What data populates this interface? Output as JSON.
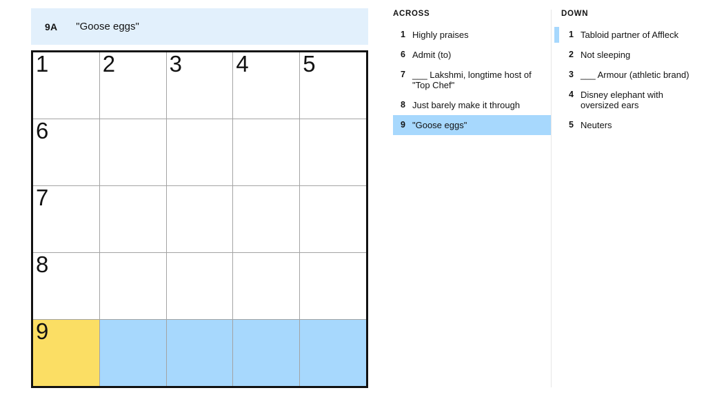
{
  "clue_bar": {
    "reference": "9A",
    "text": "\"Goose eggs\""
  },
  "grid": {
    "rows": 5,
    "cols": 5,
    "colors": {
      "cursor": "#fbde64",
      "highlight": "#a7d8fd",
      "cell": "#ffffff",
      "border": "#111111",
      "gridline": "#a3a3a3"
    },
    "cells": [
      [
        {
          "number": "1",
          "letter": "",
          "state": "empty"
        },
        {
          "number": "2",
          "letter": "",
          "state": "empty"
        },
        {
          "number": "3",
          "letter": "",
          "state": "empty"
        },
        {
          "number": "4",
          "letter": "",
          "state": "empty"
        },
        {
          "number": "5",
          "letter": "",
          "state": "empty"
        }
      ],
      [
        {
          "number": "6",
          "letter": "",
          "state": "empty"
        },
        {
          "number": "",
          "letter": "",
          "state": "empty"
        },
        {
          "number": "",
          "letter": "",
          "state": "empty"
        },
        {
          "number": "",
          "letter": "",
          "state": "empty"
        },
        {
          "number": "",
          "letter": "",
          "state": "empty"
        }
      ],
      [
        {
          "number": "7",
          "letter": "",
          "state": "empty"
        },
        {
          "number": "",
          "letter": "",
          "state": "empty"
        },
        {
          "number": "",
          "letter": "",
          "state": "empty"
        },
        {
          "number": "",
          "letter": "",
          "state": "empty"
        },
        {
          "number": "",
          "letter": "",
          "state": "empty"
        }
      ],
      [
        {
          "number": "8",
          "letter": "",
          "state": "empty"
        },
        {
          "number": "",
          "letter": "",
          "state": "empty"
        },
        {
          "number": "",
          "letter": "",
          "state": "empty"
        },
        {
          "number": "",
          "letter": "",
          "state": "empty"
        },
        {
          "number": "",
          "letter": "",
          "state": "empty"
        }
      ],
      [
        {
          "number": "9",
          "letter": "",
          "state": "cursor"
        },
        {
          "number": "",
          "letter": "",
          "state": "highlight"
        },
        {
          "number": "",
          "letter": "",
          "state": "highlight"
        },
        {
          "number": "",
          "letter": "",
          "state": "highlight"
        },
        {
          "number": "",
          "letter": "",
          "state": "highlight"
        }
      ]
    ]
  },
  "across": {
    "heading": "ACROSS",
    "clues": [
      {
        "number": "1",
        "text": "Highly praises",
        "active": false,
        "marked": false
      },
      {
        "number": "6",
        "text": "Admit (to)",
        "active": false,
        "marked": false
      },
      {
        "number": "7",
        "text": "___ Lakshmi, longtime host of \"Top Chef\"",
        "active": false,
        "marked": false
      },
      {
        "number": "8",
        "text": "Just barely make it through",
        "active": false,
        "marked": false
      },
      {
        "number": "9",
        "text": "\"Goose eggs\"",
        "active": true,
        "marked": false
      }
    ]
  },
  "down": {
    "heading": "DOWN",
    "clues": [
      {
        "number": "1",
        "text": "Tabloid partner of Affleck",
        "active": false,
        "marked": true
      },
      {
        "number": "2",
        "text": "Not sleeping",
        "active": false,
        "marked": false
      },
      {
        "number": "3",
        "text": "___ Armour (athletic brand)",
        "active": false,
        "marked": false
      },
      {
        "number": "4",
        "text": "Disney elephant with oversized ears",
        "active": false,
        "marked": false
      },
      {
        "number": "5",
        "text": "Neuters",
        "active": false,
        "marked": false
      }
    ]
  }
}
